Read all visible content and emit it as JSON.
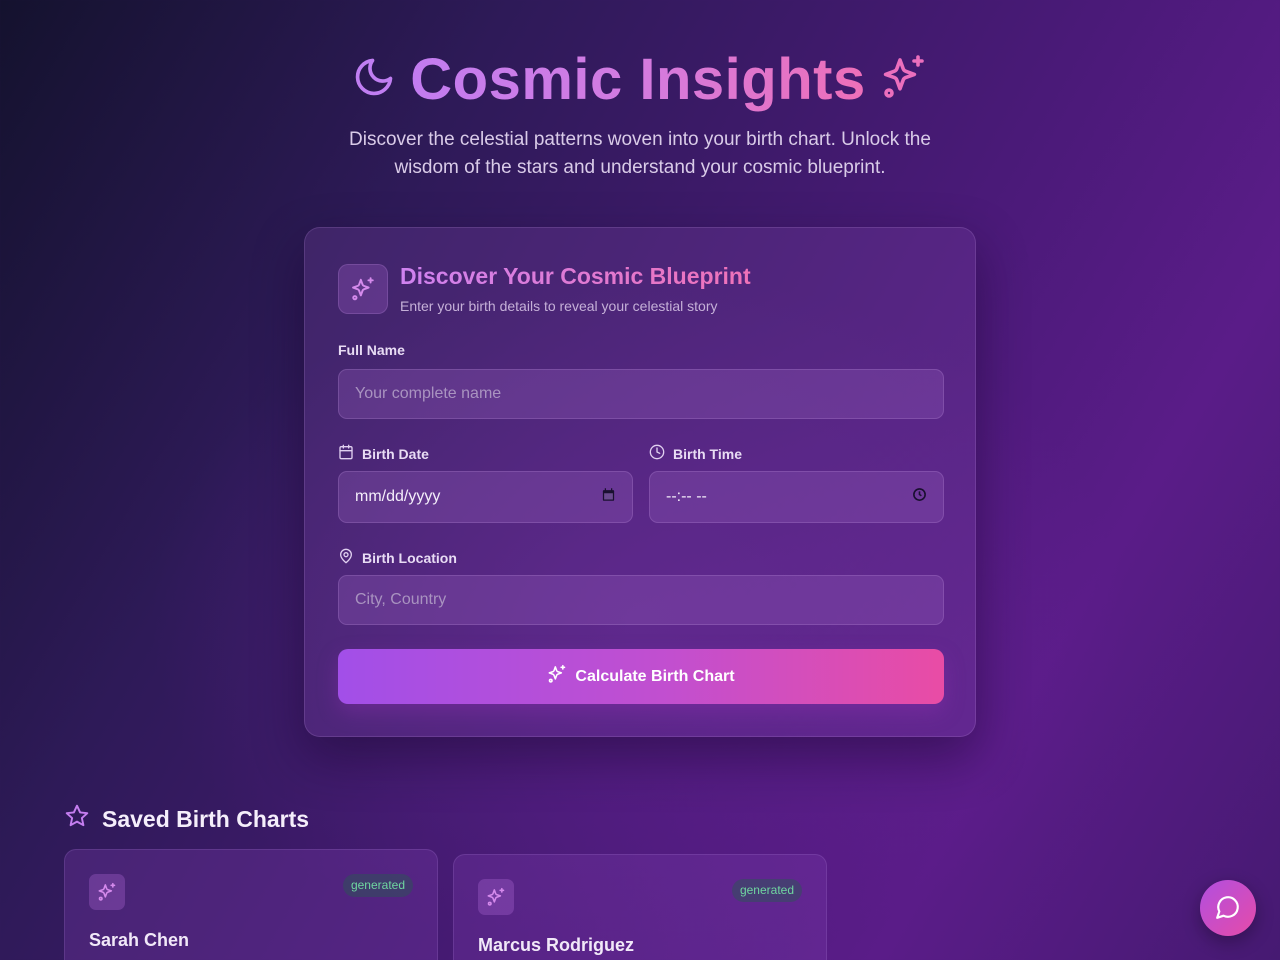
{
  "header": {
    "title": "Cosmic Insights",
    "subtitle": "Discover the celestial patterns woven into your birth chart. Unlock the wisdom of the stars and understand your cosmic blueprint."
  },
  "form": {
    "title": "Discover Your Cosmic Blueprint",
    "description": "Enter your birth details to reveal your celestial story",
    "full_name": {
      "label": "Full Name",
      "placeholder": "Your complete name"
    },
    "birth_date": {
      "label": "Birth Date",
      "value": "mm/dd/yyyy"
    },
    "birth_time": {
      "label": "Birth Time",
      "value": "--:-- --"
    },
    "birth_location": {
      "label": "Birth Location",
      "placeholder": "City, Country"
    },
    "submit_label": "Calculate Birth Chart"
  },
  "saved": {
    "title": "Saved Birth Charts",
    "charts": [
      {
        "name": "Sarah Chen",
        "status": "generated"
      },
      {
        "name": "Marcus Rodriguez",
        "status": "generated"
      }
    ]
  },
  "colors": {
    "accent_purple": "#a24fe8",
    "accent_pink": "#e94ca5",
    "status_green": "#6fd6a0"
  },
  "icons": {
    "title_left": "moon-icon",
    "title_right": "sparkles-icon",
    "date": "calendar-icon",
    "time": "clock-icon",
    "location": "map-pin-icon",
    "saved": "star-icon",
    "chat": "chat-bubble-icon"
  }
}
